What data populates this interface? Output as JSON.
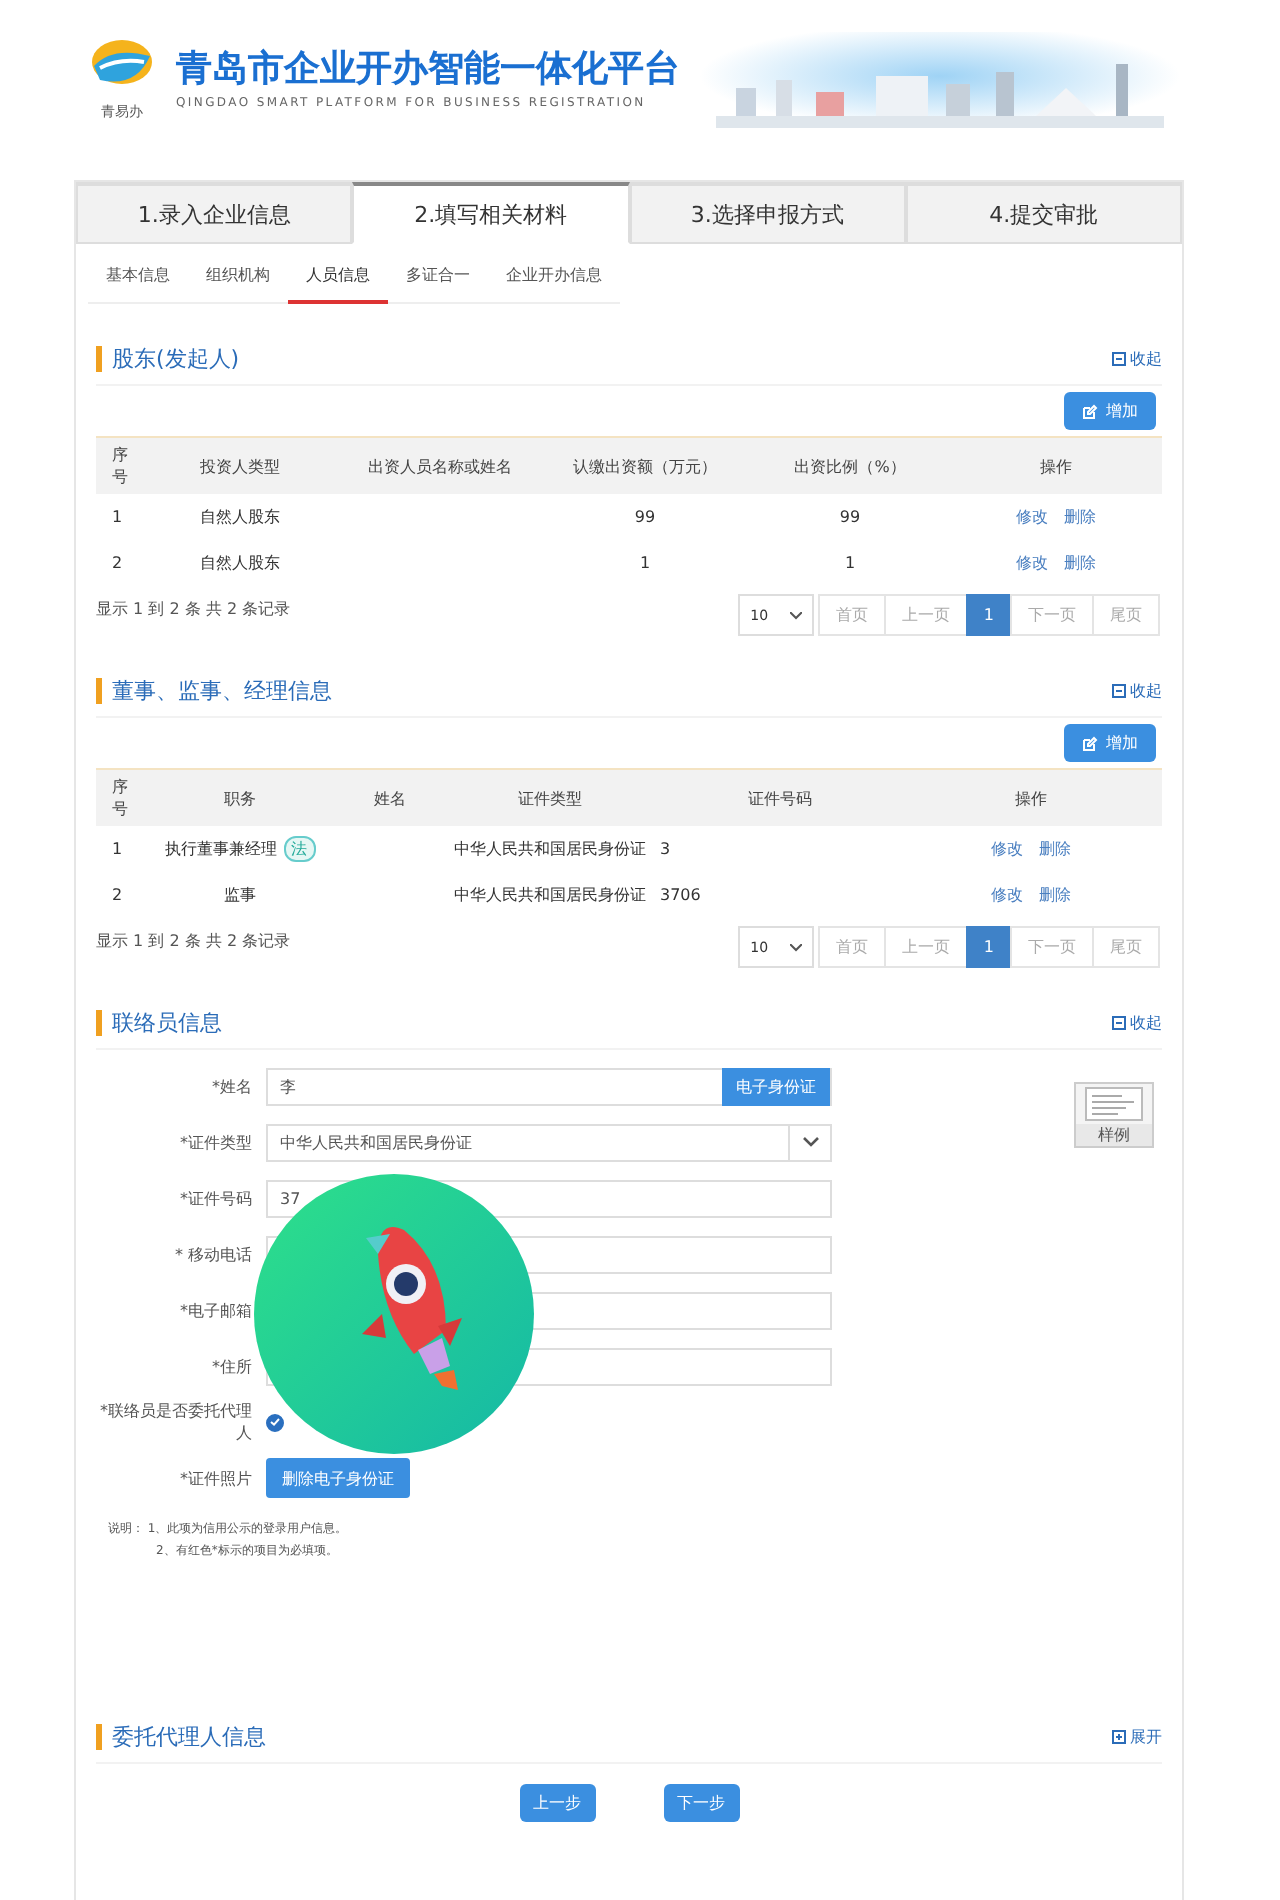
{
  "header": {
    "logo_caption": "青易办",
    "title": "青岛市企业开办智能一体化平台",
    "subtitle": "QINGDAO SMART PLATFORM FOR BUSINESS REGISTRATION"
  },
  "steps": [
    {
      "label": "1.录入企业信息",
      "selected": false
    },
    {
      "label": "2.填写相关材料",
      "selected": true
    },
    {
      "label": "3.选择申报方式",
      "selected": false
    },
    {
      "label": "4.提交审批",
      "selected": false
    }
  ],
  "subtabs": [
    {
      "label": "基本信息",
      "selected": false
    },
    {
      "label": "组织机构",
      "selected": false
    },
    {
      "label": "人员信息",
      "selected": true
    },
    {
      "label": "多证合一",
      "selected": false
    },
    {
      "label": "企业开办信息",
      "selected": false
    }
  ],
  "shareholders": {
    "title": "股东(发起人)",
    "toggle": "收起",
    "expanded": true,
    "add_button": "增加",
    "columns": [
      "序号",
      "投资人类型",
      "出资人员名称或姓名",
      "认缴出资额（万元）",
      "出资比例（%）",
      "操作"
    ],
    "rows": [
      {
        "cells": [
          "1",
          "自然人股东",
          "",
          "99",
          "99"
        ],
        "actions": [
          "修改",
          "删除"
        ]
      },
      {
        "cells": [
          "2",
          "自然人股东",
          "",
          "1",
          "1"
        ],
        "actions": [
          "修改",
          "删除"
        ]
      }
    ],
    "summary": "显示 1 到 2 条 共 2 条记录",
    "page_size": "10",
    "pages": [
      {
        "label": "首页",
        "selected": false
      },
      {
        "label": "上一页",
        "selected": false
      },
      {
        "label": "1",
        "selected": true
      },
      {
        "label": "下一页",
        "selected": false
      },
      {
        "label": "尾页",
        "selected": false
      }
    ]
  },
  "officers": {
    "title": "董事、监事、经理信息",
    "toggle": "收起",
    "expanded": true,
    "add_button": "增加",
    "columns": [
      "序号",
      "职务",
      "姓名",
      "证件类型",
      "证件号码",
      "操作"
    ],
    "rows": [
      {
        "cells": [
          "1",
          "执行董事兼经理",
          "",
          "中华人民共和国居民身份证",
          "3"
        ],
        "badge": "法",
        "actions": [
          "修改",
          "删除"
        ]
      },
      {
        "cells": [
          "2",
          "监事",
          "",
          "中华人民共和国居民身份证",
          "3706"
        ],
        "actions": [
          "修改",
          "删除"
        ]
      }
    ],
    "summary": "显示 1 到 2 条 共 2 条记录",
    "page_size": "10",
    "pages": [
      {
        "label": "首页",
        "selected": false
      },
      {
        "label": "上一页",
        "selected": false
      },
      {
        "label": "1",
        "selected": true
      },
      {
        "label": "下一页",
        "selected": false
      },
      {
        "label": "尾页",
        "selected": false
      }
    ]
  },
  "contact": {
    "title": "联络员信息",
    "toggle": "收起",
    "expanded": true,
    "sample_label": "样例",
    "fields": [
      {
        "kind": "text",
        "label": "*姓名",
        "value": "李",
        "button": "电子身份证"
      },
      {
        "kind": "select",
        "label": "*证件类型",
        "value": "中华人民共和国居民身份证"
      },
      {
        "kind": "text",
        "label": "*证件号码",
        "value": "37"
      },
      {
        "kind": "text",
        "label": "* 移动电话"
      },
      {
        "kind": "text",
        "label": "*电子邮箱"
      },
      {
        "kind": "text",
        "label": "*住所"
      },
      {
        "kind": "radio",
        "label": "*联络员是否委托代理人",
        "checked": true
      },
      {
        "kind": "button",
        "label": "*证件照片",
        "button": "删除电子身份证"
      }
    ],
    "notes": [
      "说明：  1、此项为信用公示的登录用户信息。",
      "2、有红色*标示的项目为必填项。"
    ]
  },
  "agent": {
    "title": "委托代理人信息",
    "toggle": "展开",
    "expanded": false
  },
  "nav": [
    "上一步",
    "下一步"
  ]
}
